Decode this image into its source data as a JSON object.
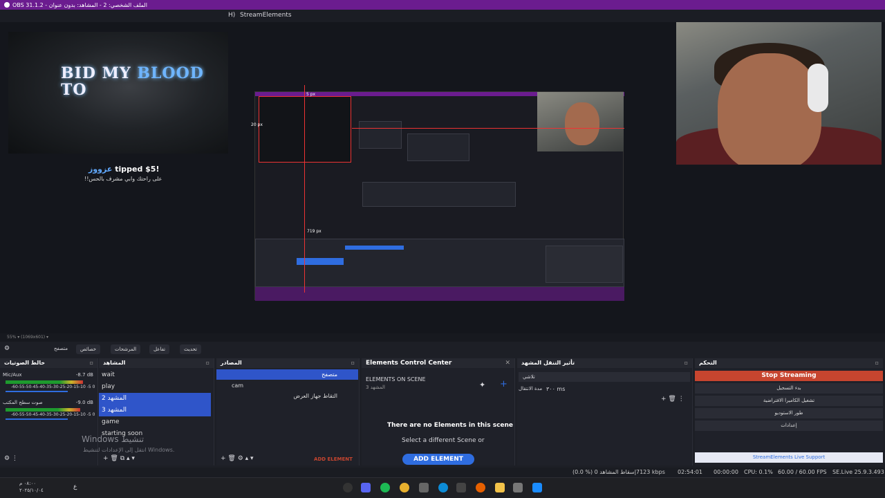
{
  "window": {
    "title": "OBS 31.1.2 - الملف الشخصي: 2 - المشاهد: بدون عنوان"
  },
  "menubar": {
    "item_h": "H)",
    "streamelements": "StreamElements"
  },
  "preview": {
    "overlay_title_line1": "BID MY ",
    "overlay_title_blue": "BLOOD",
    "overlay_title_line2": "TO",
    "tip_name": "عزووز",
    "tip_text": " tipped $5!",
    "tip_message": "!!على راحتك وابي مشرف بالحس",
    "px_label_top": "5 px",
    "px_label_left": "20 px",
    "px_label_bottom": "719 px"
  },
  "zoom": {
    "text": "55% ▾ (1069x601) ▾"
  },
  "toolbar": {
    "properties": "خصائص",
    "filters": "المرشحات",
    "interact": "تفاعل",
    "refresh": "تحديث",
    "browser_label": "متصفح"
  },
  "audio_mixer": {
    "title": "خالط الصوتيات",
    "channels": [
      {
        "name": "Mic/Aux",
        "db": "-8.7 dB",
        "level": 0.82
      },
      {
        "name": "صوت سطح المكتب",
        "db": "-9.0 dB",
        "level": 0.78
      }
    ],
    "scale": "-60-55-50-45-40-35-30-25-20-15-10 -5  0"
  },
  "scenes": {
    "title": "المشاهد",
    "items": [
      "wait",
      "play",
      "المشهد 2",
      "المشهد 3",
      "game",
      "starting soon"
    ]
  },
  "sources": {
    "title": "المصادر",
    "items": [
      "متصفح",
      "cam",
      "التقاط جهاز العرض"
    ]
  },
  "elements": {
    "title": "Elements Control Center",
    "on_scene": "ELEMENTS ON SCENE",
    "scene_name": "المشهد 3",
    "empty": "There are no Elements in this scene",
    "hint": "Select a different Scene or",
    "add_element": "ADD ELEMENT",
    "add_element_small": "ADD ELEMENT"
  },
  "transitions": {
    "title": "تأثير التنقل المشهد",
    "selected": "تلاشي",
    "duration_label": "مدة الانتقال",
    "duration_value": "٣٠٠ ms"
  },
  "controls": {
    "title": "التحكم",
    "stop": "Stop Streaming",
    "start_recording": "بدء التسجيل",
    "virtual_camera": "تشغيل الكاميرا الافتراضية",
    "studio_mode": "طور الاستوديو",
    "settings": "إعدادات",
    "live_support": "StreamElements Live Support"
  },
  "watermark": {
    "line1": "Windows تنشيط",
    "line2": "انتقل إلى الإعدادات لتنشيط Windows."
  },
  "statusbar": {
    "dropped": "(0.0 %) 0 إسقاط المشاهد",
    "bitrate": "7123 kbps",
    "live_time": "02:54:01",
    "rec_time": "00:00:00",
    "cpu": "CPU: 0.1%",
    "fps": "60.00 / 60.00 FPS",
    "se_version": "SE.Live 25.9.3.493"
  },
  "taskbar": {
    "time": "٠٨:٠٠ م",
    "date": "٢٠٢٥/١٠/٠٤",
    "lang": "ع"
  },
  "colors": {
    "accent": "#6b1c8f",
    "selection": "#2f55c9",
    "stop": "#c7452f",
    "button": "#2f6de0"
  }
}
